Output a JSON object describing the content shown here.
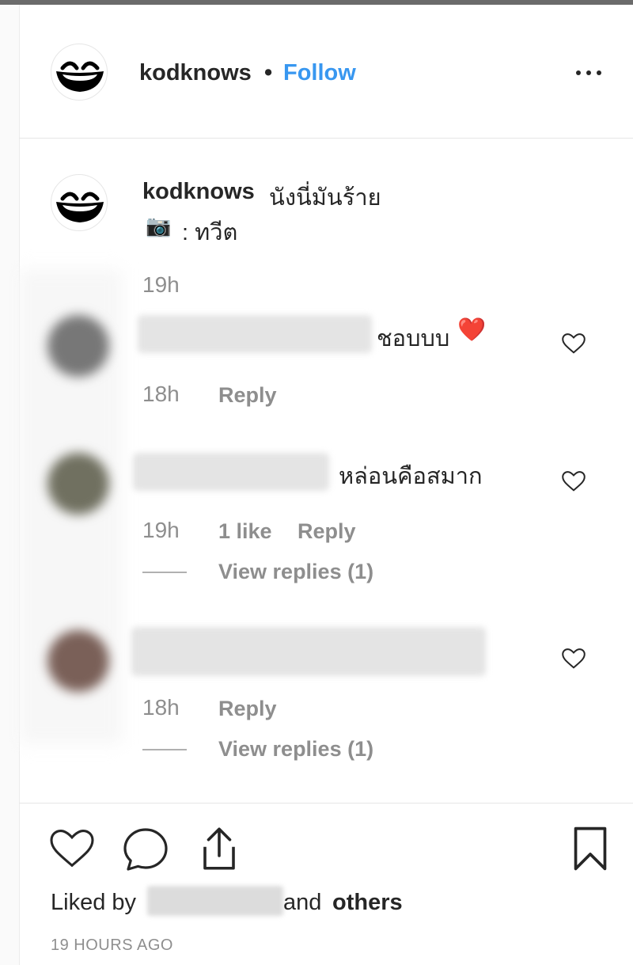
{
  "header": {
    "username": "kodknows",
    "separator": "•",
    "follow_label": "Follow",
    "more_icon": "more-horizontal-icon"
  },
  "caption": {
    "username": "kodknows",
    "text": "นังนี่มันร้าย",
    "camera_emoji": "📷",
    "credit": ": ทวีต",
    "time": "19h"
  },
  "comments": [
    {
      "text": "ชอบบบ",
      "emoji": "❤️",
      "time": "18h",
      "reply_label": "Reply"
    },
    {
      "text": "หล่อนคือสมาก",
      "time": "19h",
      "likes": "1 like",
      "reply_label": "Reply",
      "view_replies": "View replies (1)"
    },
    {
      "text": "",
      "time": "18h",
      "reply_label": "Reply",
      "view_replies": "View replies (1)"
    }
  ],
  "footer": {
    "liked_by_prefix": "Liked by",
    "liked_by_suffix": "and",
    "others": "others",
    "time_ago": "19 HOURS AGO"
  },
  "colors": {
    "accent": "#3897f0",
    "text": "#262626",
    "muted": "#8e8e8e",
    "heart": "#e0245e"
  }
}
